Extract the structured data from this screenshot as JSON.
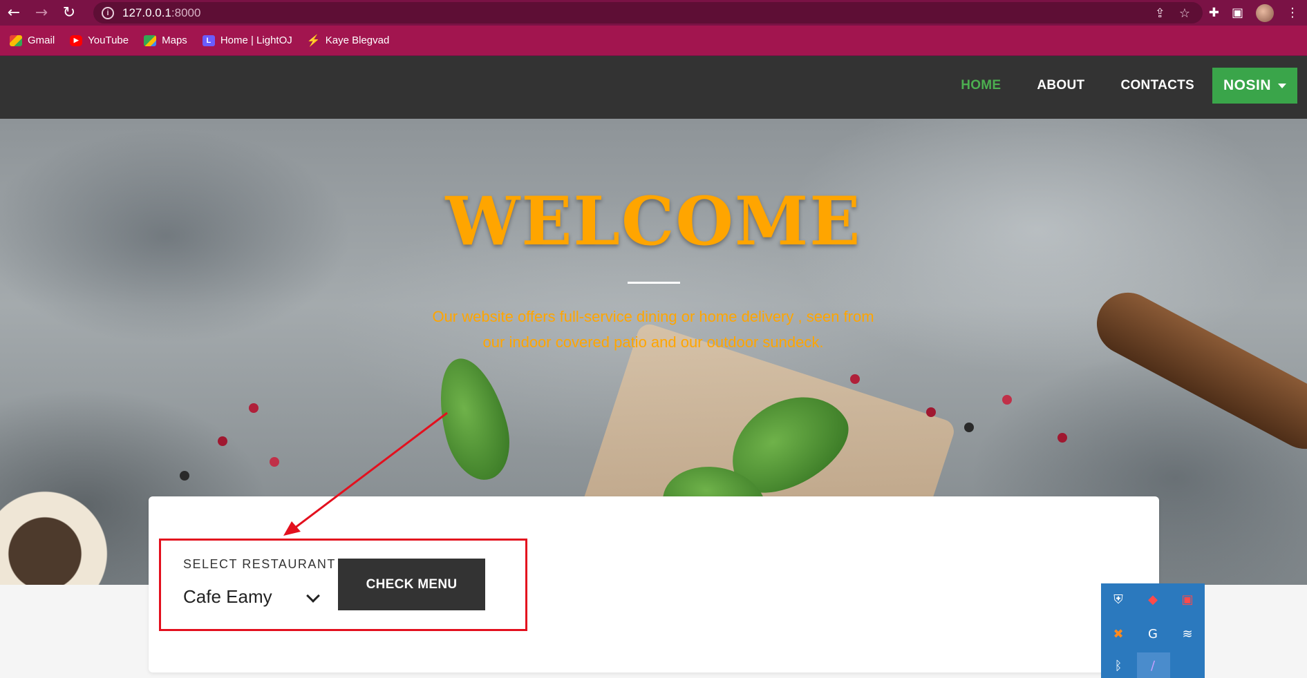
{
  "browser": {
    "url_host": "127.0.0.1",
    "url_port": ":8000",
    "bookmarks": [
      {
        "label": "Gmail",
        "icon": "gmail-icon"
      },
      {
        "label": "YouTube",
        "icon": "youtube-icon"
      },
      {
        "label": "Maps",
        "icon": "maps-icon"
      },
      {
        "label": "Home | LightOJ",
        "icon": "lightoj-icon"
      },
      {
        "label": "Kaye Blegvad",
        "icon": "bolt-icon"
      }
    ],
    "lightoj_icon_letter": "L"
  },
  "nav": {
    "items": [
      "HOME",
      "ABOUT",
      "CONTACTS"
    ],
    "active_item": "HOME",
    "user_label": "NOSIN",
    "active_color": "#4caf50",
    "user_button_color": "#3aa54a"
  },
  "hero": {
    "title": "WELCOME",
    "subtitle_line1": "Our website offers full-service dining or home delivery , seen from",
    "subtitle_line2": "our indoor covered patio and our outdoor sundeck.",
    "title_color": "#ffa500"
  },
  "search": {
    "label": "SELECT RESTAURANT",
    "selected": "Cafe Eamy",
    "button": "CHECK MENU",
    "highlight_color": "#e3101e"
  },
  "tray": {
    "icons": [
      "security-shield-icon",
      "anydesk-icon",
      "screen-recorder-icon",
      "xampp-icon",
      "grammarly-icon",
      "wifi-icon",
      "bluetooth-icon",
      "pen-icon"
    ]
  }
}
